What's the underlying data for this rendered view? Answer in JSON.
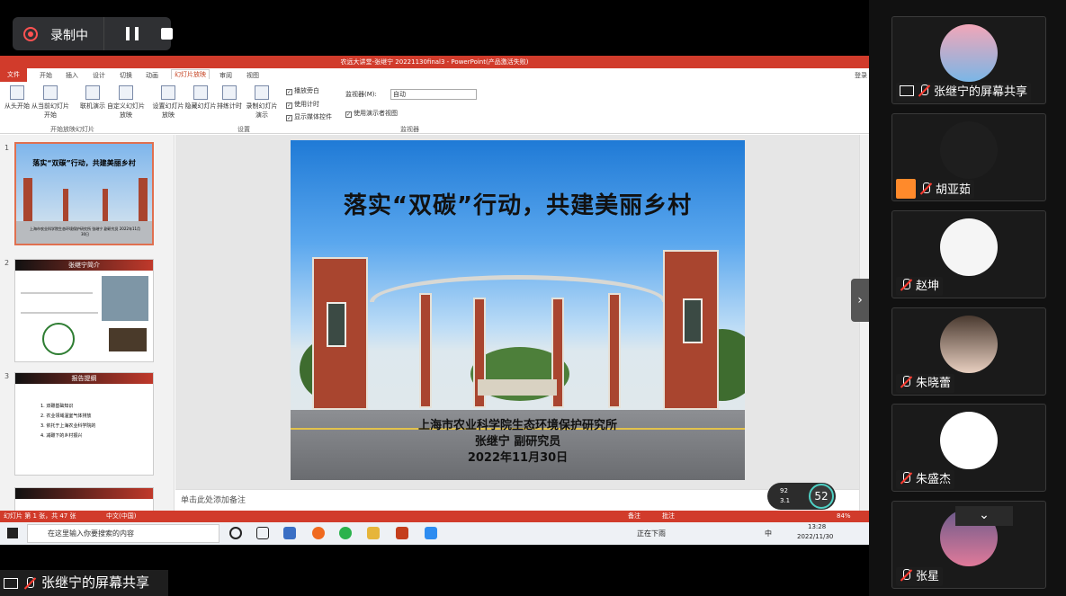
{
  "recording": {
    "label": "录制中"
  },
  "ppt": {
    "window_title": "农远大讲堂-张继宁 20221130final3 - PowerPoint(产品激活失败)",
    "tabs": [
      "文件",
      "开始",
      "插入",
      "设计",
      "切换",
      "动画",
      "幻灯片放映",
      "审阅",
      "视图"
    ],
    "active_tab": "幻灯片放映",
    "login": "登录",
    "ribbon": {
      "from_start": "从头开始",
      "from_current": "从当前幻灯片开始",
      "online": "联机演示",
      "custom": "自定义幻灯片放映",
      "setup": "设置幻灯片放映",
      "hide": "隐藏幻灯片",
      "rehearse": "排练计时",
      "record": "录制幻灯片演示",
      "play_narration": "播放旁白",
      "use_timings": "使用计时",
      "show_media": "显示媒体控件",
      "monitor_label": "监视器(M):",
      "monitor_value": "自动",
      "presenter_view": "使用演示者视图",
      "group_start": "开始放映幻灯片",
      "group_setup": "设置",
      "group_monitor": "监视器"
    },
    "thumbnails": [
      {
        "num": "1",
        "title": "落实“双碳”行动，共建美丽乡村",
        "sub": "上海市农业科学院生态环境保护研究所 张继宁 副研究员 2022年11月30日"
      },
      {
        "num": "2",
        "title": "张继宁简介"
      },
      {
        "num": "3",
        "title": "报告提纲",
        "items": [
          "1. 双碳基础知识",
          "2. 农业领域温室气体排放",
          "3. 依托于上海农业科学院的",
          "4. 减碳下的乡村振兴"
        ]
      }
    ],
    "slide": {
      "title": "落实“双碳”行动，共建美丽乡村",
      "institute": "上海市农业科学院生态环境保护研究所",
      "author": "张继宁  副研究员",
      "date": "2022年11月30日"
    },
    "notes_placeholder": "单击此处添加备注",
    "status": {
      "slide_info": "幻灯片 第 1 张，共 47 张",
      "language": "中文(中国)",
      "notes": "备注",
      "comments": "批注",
      "zoom": "84%"
    },
    "taskbar": {
      "search_placeholder": "在这里输入你要搜索的内容",
      "weather": "正在下雨",
      "ime": "中",
      "time": "13:28",
      "date": "2022/11/30"
    }
  },
  "speed": {
    "cpu": "92",
    "net": "3.1",
    "percent": "52"
  },
  "presenter_label": "张继宁的屏幕共享",
  "participants": [
    {
      "name": "张继宁的屏幕共享",
      "type": "screen"
    },
    {
      "name": "胡亚茹",
      "type": "person"
    },
    {
      "name": "赵坤",
      "type": "muted"
    },
    {
      "name": "朱晓蕾",
      "type": "muted"
    },
    {
      "name": "朱盛杰",
      "type": "muted"
    },
    {
      "name": "张星",
      "type": "muted"
    }
  ],
  "colors": {
    "ppt_red": "#d13b2b",
    "panel_bg": "#111111",
    "muted_red": "#ff3b30"
  }
}
